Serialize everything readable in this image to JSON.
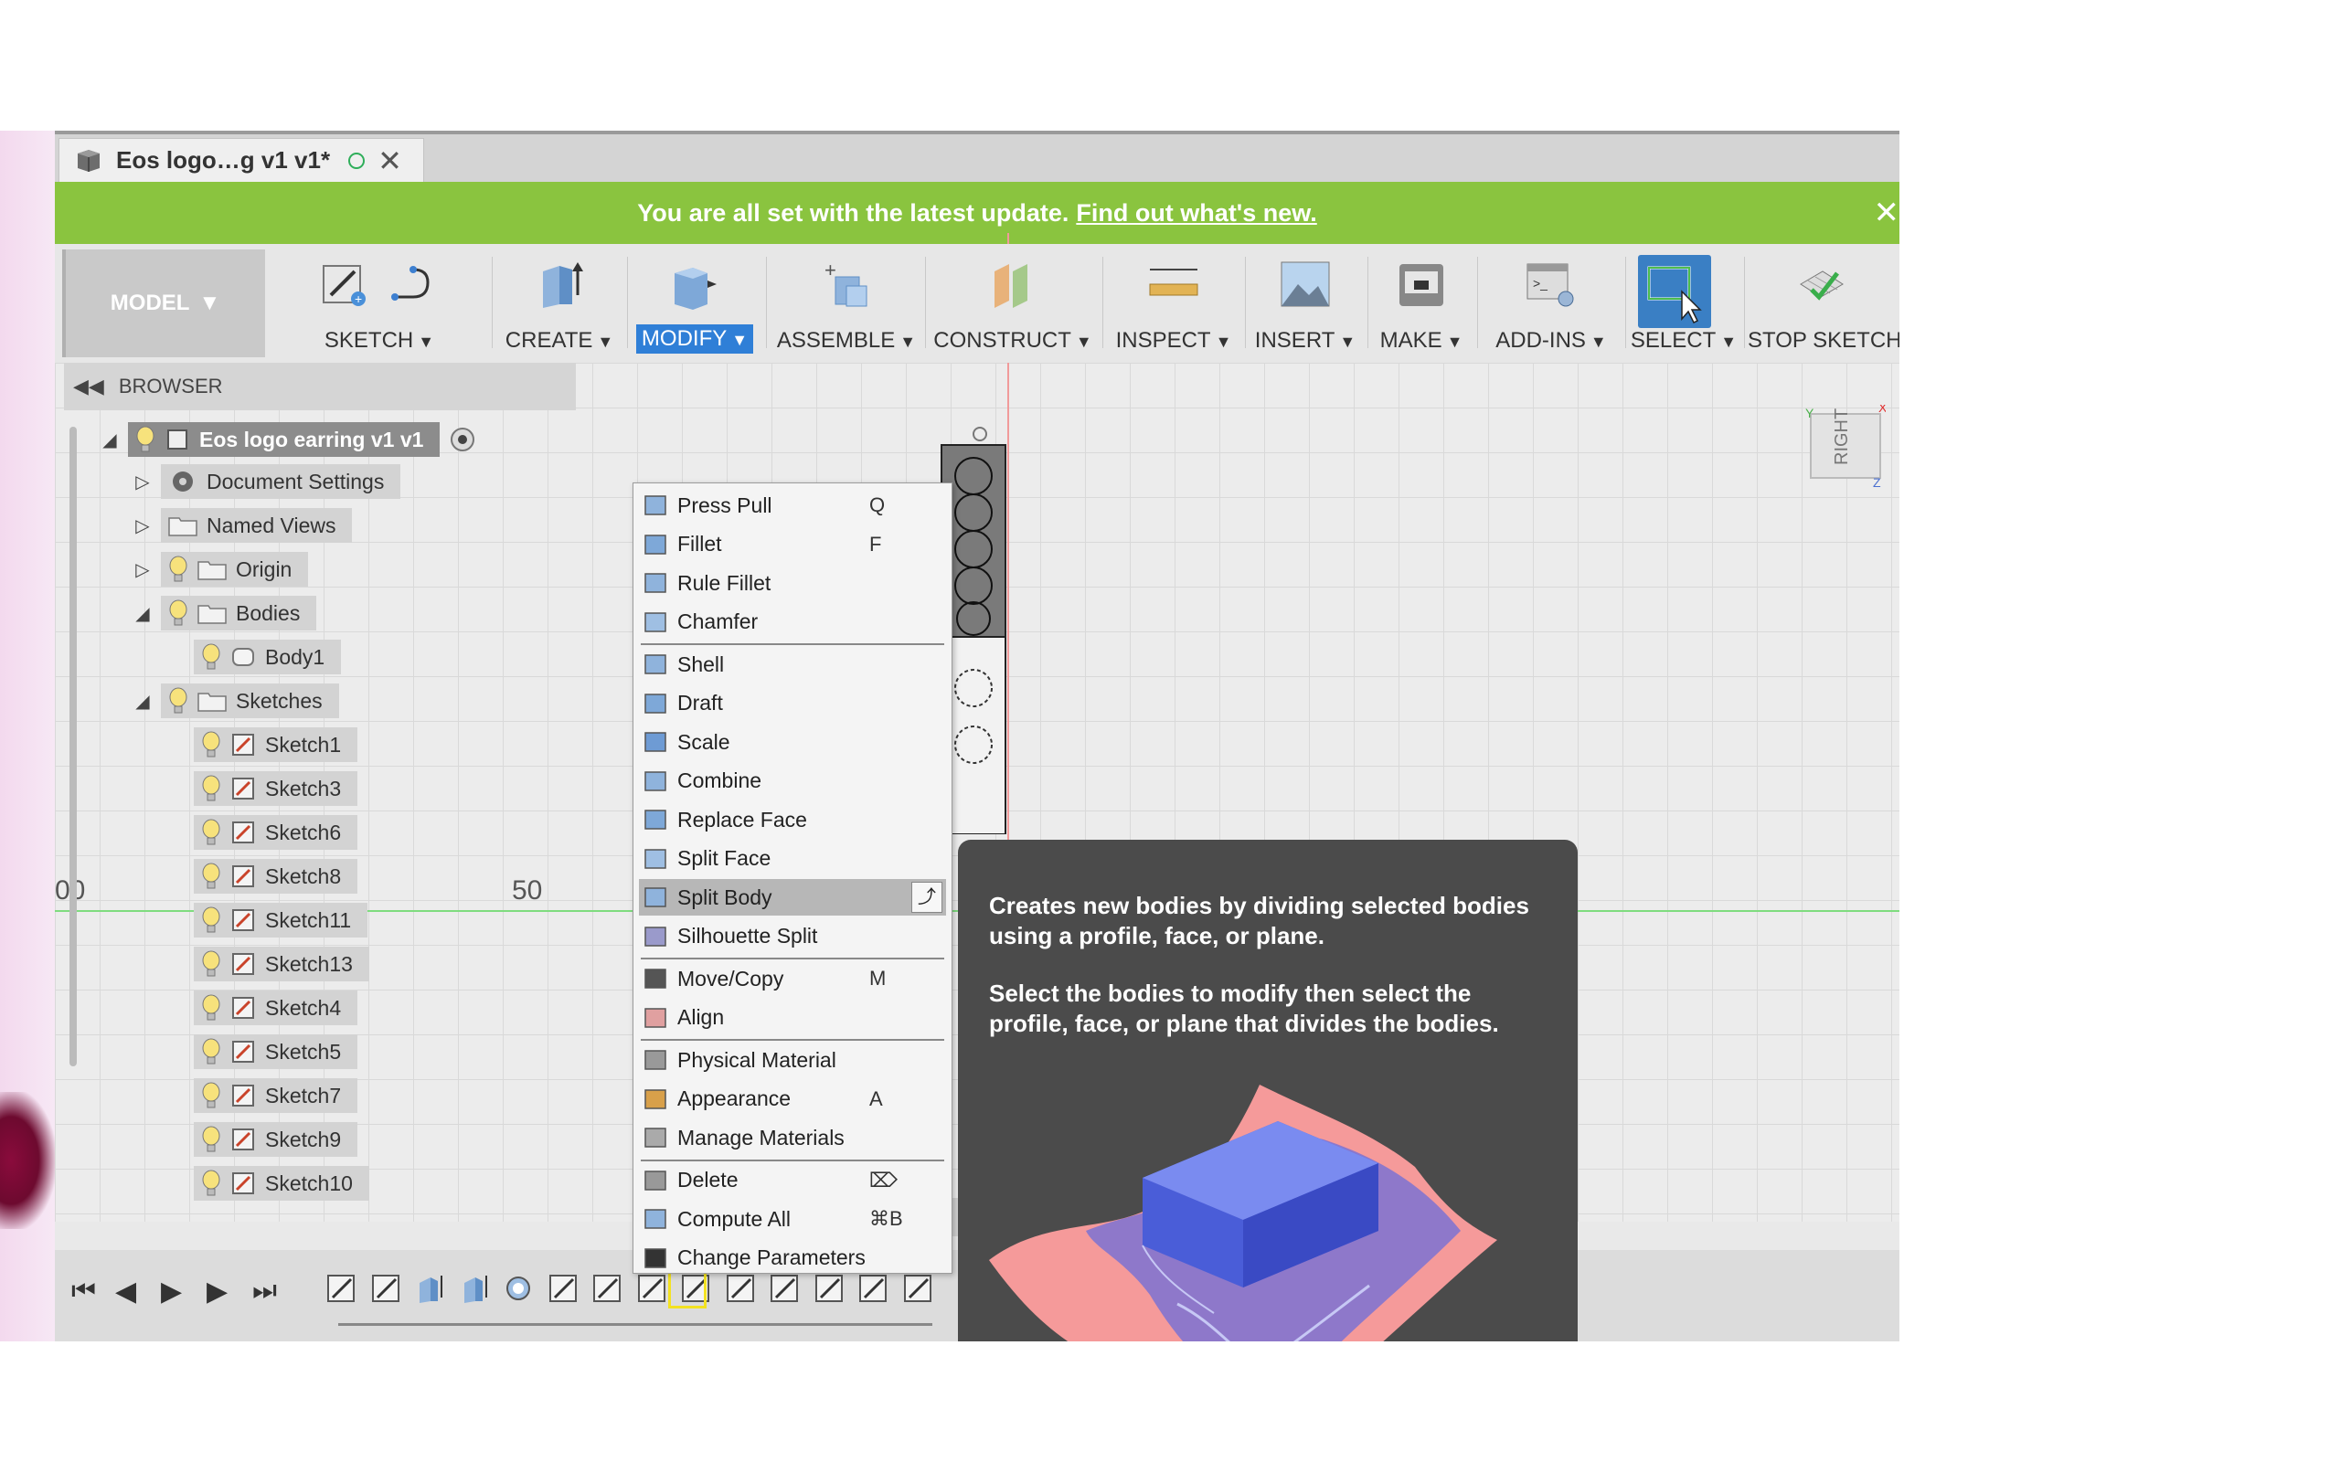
{
  "window": {
    "tab_title": "Eos logo…g v1 v1*",
    "tab_close": "✕"
  },
  "banner": {
    "text": "You are all set with the latest update.",
    "link": "Find out what's new.",
    "close": "✕"
  },
  "toolbar": {
    "workspace": "MODEL",
    "groups": [
      {
        "label": "SKETCH"
      },
      {
        "label": "CREATE"
      },
      {
        "label": "MODIFY"
      },
      {
        "label": "ASSEMBLE"
      },
      {
        "label": "CONSTRUCT"
      },
      {
        "label": "INSPECT"
      },
      {
        "label": "INSERT"
      },
      {
        "label": "MAKE"
      },
      {
        "label": "ADD-INS"
      },
      {
        "label": "SELECT"
      },
      {
        "label": "STOP SKETCH"
      }
    ]
  },
  "browser": {
    "title": "BROWSER",
    "root": "Eos logo earring v1 v1",
    "nodes": [
      {
        "label": "Document Settings"
      },
      {
        "label": "Named Views"
      },
      {
        "label": "Origin"
      },
      {
        "label": "Bodies"
      },
      {
        "label": "Body1"
      },
      {
        "label": "Sketches"
      }
    ],
    "sketches": [
      "Sketch1",
      "Sketch3",
      "Sketch6",
      "Sketch8",
      "Sketch11",
      "Sketch13",
      "Sketch4",
      "Sketch5",
      "Sketch7",
      "Sketch9",
      "Sketch10"
    ]
  },
  "canvas": {
    "ruler_left": "00",
    "ruler_50": "50",
    "viewcube_face": "RIGHT",
    "axis_x": "X",
    "axis_y": "Y",
    "axis_z": "Z"
  },
  "modify_menu": {
    "items": [
      {
        "label": "Press Pull",
        "shortcut": "Q",
        "icon": "press-pull-icon"
      },
      {
        "label": "Fillet",
        "shortcut": "F",
        "icon": "fillet-icon"
      },
      {
        "label": "Rule Fillet",
        "shortcut": "",
        "icon": "rule-fillet-icon"
      },
      {
        "label": "Chamfer",
        "shortcut": "",
        "icon": "chamfer-icon"
      },
      {
        "label": "Shell",
        "shortcut": "",
        "icon": "shell-icon"
      },
      {
        "label": "Draft",
        "shortcut": "",
        "icon": "draft-icon"
      },
      {
        "label": "Scale",
        "shortcut": "",
        "icon": "scale-icon"
      },
      {
        "label": "Combine",
        "shortcut": "",
        "icon": "combine-icon"
      },
      {
        "label": "Replace Face",
        "shortcut": "",
        "icon": "replace-face-icon"
      },
      {
        "label": "Split Face",
        "shortcut": "",
        "icon": "split-face-icon"
      },
      {
        "label": "Split Body",
        "shortcut": "",
        "icon": "split-body-icon"
      },
      {
        "label": "Silhouette Split",
        "shortcut": "",
        "icon": "silhouette-split-icon"
      },
      {
        "label": "Move/Copy",
        "shortcut": "M",
        "icon": "move-copy-icon"
      },
      {
        "label": "Align",
        "shortcut": "",
        "icon": "align-icon"
      },
      {
        "label": "Physical Material",
        "shortcut": "",
        "icon": "physical-material-icon"
      },
      {
        "label": "Appearance",
        "shortcut": "A",
        "icon": "appearance-icon"
      },
      {
        "label": "Manage Materials",
        "shortcut": "",
        "icon": "manage-materials-icon"
      },
      {
        "label": "Delete",
        "shortcut": "⌦",
        "icon": "delete-icon"
      },
      {
        "label": "Compute All",
        "shortcut": "⌘B",
        "icon": "compute-all-icon"
      },
      {
        "label": "Change Parameters",
        "shortcut": "",
        "icon": "change-parameters-icon"
      }
    ],
    "highlighted": "Split Body"
  },
  "tooltip": {
    "p1": "Creates new bodies by dividing selected bodies using a profile, face, or plane.",
    "p2": "Select the bodies to modify then select the profile, face, or plane that divides the bodies."
  },
  "timeline": {
    "controls": [
      "⏮",
      "◀",
      "▶",
      "▶",
      "⏭"
    ]
  },
  "colors": {
    "banner": "#8ac43f",
    "modify_active": "#2f7fd7",
    "select_active": "#3a7fc4",
    "tooltip_bg": "#4b4b4b",
    "timeline_current": "#f3e221"
  }
}
